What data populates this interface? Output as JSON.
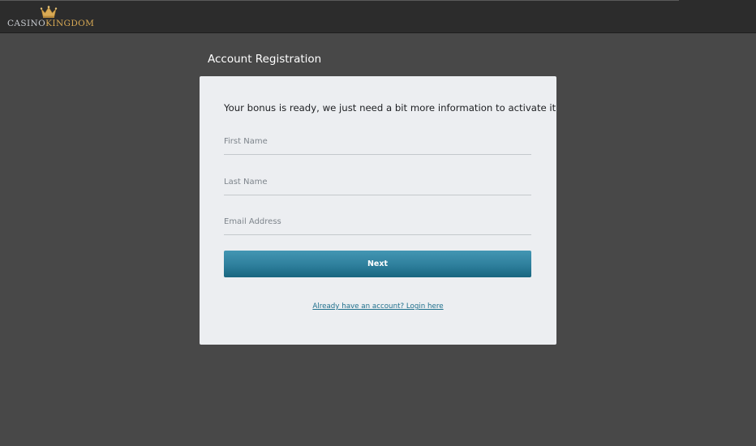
{
  "brand": {
    "logo_casino": "CASINO",
    "logo_kingdom": "KINGDOM",
    "crown_icon": "crown-icon",
    "colors": {
      "topbar": "#2c2c2c",
      "background": "#484848",
      "gold": "#d9aa55",
      "card": "#eceef1",
      "button": "#2e7f9c",
      "link": "#1e6f8c"
    }
  },
  "page": {
    "title": "Account Registration"
  },
  "form": {
    "heading": "Your bonus is ready, we just need a bit more information to activate it",
    "first_name_placeholder": "First Name",
    "last_name_placeholder": "Last Name",
    "email_placeholder": "Email Address",
    "next_label": "Next",
    "login_link": "Already have an account? Login here"
  }
}
